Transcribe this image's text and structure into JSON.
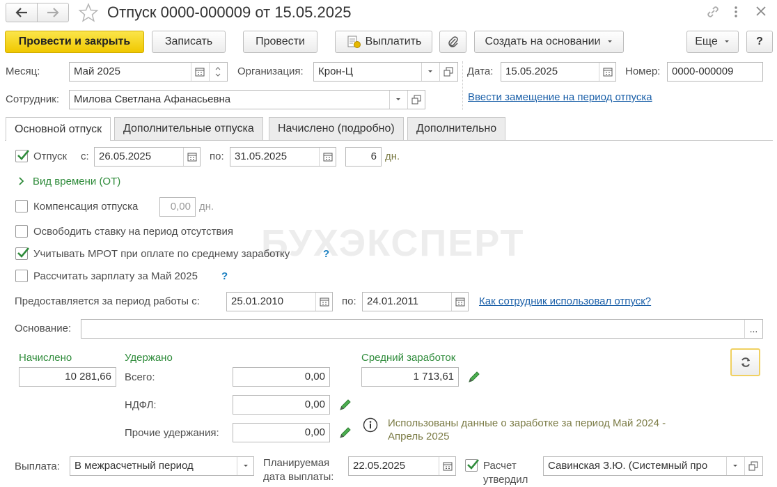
{
  "window": {
    "title": "Отпуск 0000-000009 от 15.05.2025"
  },
  "toolbar": {
    "post_close": "Провести и закрыть",
    "save": "Записать",
    "post": "Провести",
    "pay": "Выплатить",
    "create_based": "Создать на основании",
    "more": "Еще",
    "help": "?"
  },
  "header": {
    "month_label": "Месяц:",
    "month_value": "Май 2025",
    "org_label": "Организация:",
    "org_value": "Крон-Ц",
    "date_label": "Дата:",
    "date_value": "15.05.2025",
    "number_label": "Номер:",
    "number_value": "0000-000009",
    "employee_label": "Сотрудник:",
    "employee_value": "Милова Светлана Афанасьевна",
    "replacement_link": "Ввести замещение на период отпуска"
  },
  "tabs": [
    {
      "label": "Основной отпуск",
      "active": true
    },
    {
      "label": "Дополнительные отпуска",
      "active": false
    },
    {
      "label": "Начислено (подробно)",
      "active": false
    },
    {
      "label": "Дополнительно",
      "active": false
    }
  ],
  "main": {
    "vacation_label": "Отпуск",
    "vacation_checked": true,
    "from_label": "с:",
    "from_value": "26.05.2025",
    "to_label": "по:",
    "to_value": "31.05.2025",
    "days_value": "6",
    "days_unit": "дн.",
    "time_kind": "Вид времени (ОТ)",
    "compensation_label": "Компенсация отпуска",
    "compensation_checked": false,
    "compensation_value": "0,00",
    "compensation_unit": "дн.",
    "free_rate_label": "Освободить ставку на период отсутствия",
    "free_rate_checked": false,
    "mrot_label": "Учитывать МРОТ при оплате по среднему заработку",
    "mrot_checked": true,
    "mrot_help": "?",
    "calc_salary_label": "Рассчитать зарплату за Май 2025",
    "calc_salary_checked": false,
    "calc_salary_help": "?",
    "period_label": "Предоставляется за период работы с:",
    "period_from": "25.01.2010",
    "period_to_label": "по:",
    "period_to": "24.01.2011",
    "usage_link": "Как сотрудник использовал отпуск?",
    "basis_label": "Основание:",
    "basis_value": "",
    "basis_btn": "...",
    "watermark": "БУХЭКСПЕРТ"
  },
  "totals": {
    "accrued_label": "Начислено",
    "accrued_value": "10 281,66",
    "withheld_label": "Удержано",
    "total_label": "Всего:",
    "total_value": "0,00",
    "ndfl_label": "НДФЛ:",
    "ndfl_value": "0,00",
    "other_label": "Прочие удержания:",
    "other_value": "0,00",
    "avg_label": "Средний заработок",
    "avg_value": "1 713,61",
    "info_text_1": "Использованы данные о заработке за период Май 2024 -",
    "info_text_2": "Апрель 2025"
  },
  "footer": {
    "payment_label": "Выплата:",
    "payment_value": "В межрасчетный период",
    "planned_label_1": "Планируемая",
    "planned_label_2": "дата выплаты:",
    "planned_value": "22.05.2025",
    "approved_label_1": "Расчет",
    "approved_label_2": "утвердил",
    "approved_checked": true,
    "approver_value": "Савинская З.Ю. (Системный про"
  },
  "colors": {
    "accent_yellow": "#f0c800",
    "link_blue": "#1a5fa8",
    "green_label": "#2e8b3a"
  }
}
